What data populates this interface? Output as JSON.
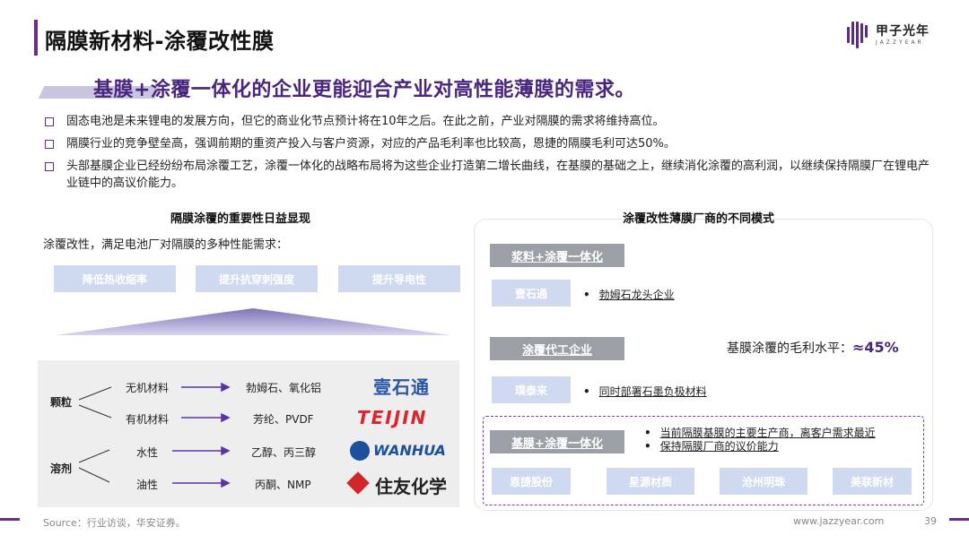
{
  "header": {
    "title": "隔膜新材料-涂覆改性膜",
    "logo_cn": "甲子光年",
    "logo_en": "JAZZYEAR"
  },
  "subtitle": "基膜+涂覆一体化的企业更能迎合产业对高性能薄膜的需求。",
  "bullets": [
    "固态电池是未来锂电的发展方向，但它的商业化节点预计将在10年之后。在此之前，产业对隔膜的需求将维持高位。",
    "隔膜行业的竞争壁垒高，强调前期的重资产投入与客户资源，对应的产品毛利率也比较高，恩捷的隔膜毛利可达50%。",
    "头部基膜企业已经纷纷布局涂覆工艺，涂覆一体化的战略布局将为这些企业打造第二增长曲线，在基膜的基础之上，继续消化涂覆的高利润，以继续保持隔膜厂在锂电产业链中的高议价能力。"
  ],
  "left": {
    "heading": "隔膜涂覆的重要性日益显现",
    "desc": "涂覆改性，满足电池厂对隔膜的多种性能需求：",
    "needs": [
      "降低热收缩率",
      "提升抗穿刺强度",
      "提升导电性"
    ],
    "categories": {
      "particle": "颗粒",
      "solvent": "溶剂"
    },
    "rows": [
      {
        "type": "无机材料",
        "material": "勃姆石、氧化铝",
        "brand": "壹石通"
      },
      {
        "type": "有机材料",
        "material": "芳纶、PVDF",
        "brand": "TEIJIN"
      },
      {
        "type": "水性",
        "material": "乙醇、丙三醇",
        "brand": "WANHUA"
      },
      {
        "type": "油性",
        "material": "丙酮、NMP",
        "brand": "住友化学"
      }
    ]
  },
  "right": {
    "heading": "涂覆改性薄膜厂商的不同模式",
    "mode1": {
      "label": "浆料+涂覆一体化",
      "company": "壹石通",
      "note": "勃姆石龙头企业"
    },
    "mode2": {
      "label": "涂覆代工企业",
      "company": "璞泰来",
      "note": "同时部署石墨负极材料"
    },
    "margin": {
      "label": "基膜涂覆的毛利水平：",
      "value": "≈45%"
    },
    "mode3": {
      "label": "基膜+涂覆一体化",
      "notes": [
        "当前隔膜基膜的主要生产商，离客户需求最近",
        "保持隔膜厂商的议价能力"
      ],
      "companies": [
        "恩捷股份",
        "星源材质",
        "沧州明珠",
        "美联新材"
      ]
    }
  },
  "footer": {
    "source": "Source：行业访谈，华安证券。",
    "url": "www.jazzyear.com",
    "page": "39"
  },
  "colors": {
    "accent": "#6a2c91",
    "subtitle": "#4a2580",
    "pill": "#cfdaf0",
    "mode_label": "#9aa0a6"
  }
}
